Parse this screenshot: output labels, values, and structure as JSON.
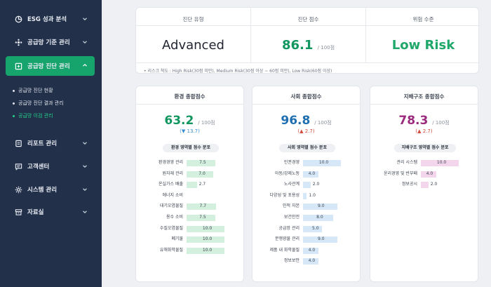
{
  "sidebar": {
    "items": [
      {
        "label": "ESG 성과 분석",
        "icon": "pie-chart-icon"
      },
      {
        "label": "공급망 기준 관리",
        "icon": "network-icon"
      },
      {
        "label": "공급망 진단 관리",
        "icon": "clipboard-icon",
        "active": true
      },
      {
        "label": "리포트 관리",
        "icon": "report-icon"
      },
      {
        "label": "고객센터",
        "icon": "chat-icon"
      },
      {
        "label": "시스템 관리",
        "icon": "gear-icon"
      },
      {
        "label": "자료실",
        "icon": "archive-icon"
      }
    ],
    "sub_items": [
      {
        "label": "공급망 진단 현황"
      },
      {
        "label": "공급망 진단 결과 관리"
      },
      {
        "label": "공급망 이검 관리",
        "active": true
      }
    ]
  },
  "summary": {
    "type_label": "진단 유형",
    "type_value": "Advanced",
    "score_label": "진단 점수",
    "score_value": "86.1",
    "score_unit": "/ 100점",
    "risk_label": "위험 수준",
    "risk_value": "Low Risk",
    "footnote": "• 리스크 척도 : High Risk(30점 미만), Medium Risk(30점 이상 ~ 60점 미만), Low Risk(60점 이상)"
  },
  "cards": {
    "env": {
      "title": "환경 종합점수",
      "score": "63.2",
      "unit": "/ 100점",
      "delta": "(▼ 13.7)",
      "pill": "환경 영역별 점수 분포",
      "rows": [
        {
          "label": "환경경영 관리",
          "value": 7.5,
          "text": "7.5"
        },
        {
          "label": "원자재 관리",
          "value": 7.0,
          "text": "7.0"
        },
        {
          "label": "온실가스 배출",
          "value": 2.7,
          "text": "2.7"
        },
        {
          "label": "에너지 소비",
          "value": 0,
          "text": ""
        },
        {
          "label": "대기오염물질",
          "value": 7.7,
          "text": "7.7"
        },
        {
          "label": "용수 소비",
          "value": 7.5,
          "text": "7.5"
        },
        {
          "label": "수질오염물질",
          "value": 10.0,
          "text": "10.0"
        },
        {
          "label": "폐기물",
          "value": 10.0,
          "text": "10.0"
        },
        {
          "label": "유해화학물질",
          "value": 10.0,
          "text": "10.0"
        }
      ]
    },
    "soc": {
      "title": "사회 종합점수",
      "score": "96.8",
      "unit": "/ 100점",
      "delta": "(▲ 2.7)",
      "pill": "사회 영역별 점수 분포",
      "rows": [
        {
          "label": "인권경영",
          "value": 10.0,
          "text": "10.0"
        },
        {
          "label": "아동/강제노동",
          "value": 4.0,
          "text": "4.0"
        },
        {
          "label": "노사관계",
          "value": 2.0,
          "text": "2.0"
        },
        {
          "label": "다양성 및 포용성",
          "value": 1.0,
          "text": "1.0"
        },
        {
          "label": "인적 자본",
          "value": 9.0,
          "text": "9.0"
        },
        {
          "label": "보건안전",
          "value": 8.0,
          "text": "8.0"
        },
        {
          "label": "공급망 관리",
          "value": 5.0,
          "text": "5.0"
        },
        {
          "label": "분쟁광물 관리",
          "value": 9.0,
          "text": "9.0"
        },
        {
          "label": "제품 내 화학물질",
          "value": 4.0,
          "text": "4.0"
        },
        {
          "label": "정보보안",
          "value": 4.0,
          "text": "4.0"
        }
      ]
    },
    "gov": {
      "title": "지배구조 종합점수",
      "score": "78.3",
      "unit": "/ 100점",
      "delta": "(▲ 2.7)",
      "pill": "지배구조 영역별 점수 분포",
      "rows": [
        {
          "label": "관리 시스템",
          "value": 10.0,
          "text": "10.0"
        },
        {
          "label": "윤리경영 및 반부패",
          "value": 4.0,
          "text": "4.0"
        },
        {
          "label": "정보공시",
          "value": 2.0,
          "text": "2.0"
        }
      ]
    }
  },
  "colors": {
    "sidebar_bg": "#23304a",
    "active_green": "#16a36c",
    "env_green": "#12965f",
    "soc_blue": "#1f6fb0",
    "gov_purple": "#9b2a7d",
    "delta_down": "#3a8fd0",
    "delta_up": "#d24a3c"
  }
}
